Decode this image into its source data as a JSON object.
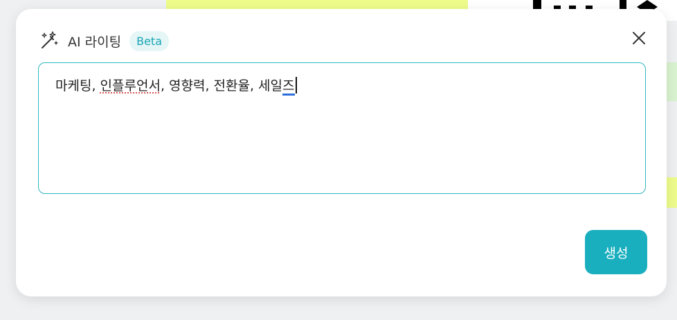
{
  "header": {
    "title": "AI 라이팅",
    "badge": "Beta",
    "icon": "magic-wand-icon"
  },
  "close": {
    "icon": "close-icon"
  },
  "editor": {
    "segments": [
      {
        "text": "마케팅, ",
        "style": "normal"
      },
      {
        "text": "인플루언서",
        "style": "misspelled"
      },
      {
        "text": ", 영향력, 전환율, 세일",
        "style": "normal"
      },
      {
        "text": "즈",
        "style": "composing"
      }
    ]
  },
  "actions": {
    "generate_label": "생성"
  },
  "colors": {
    "accent": "#1aafbe",
    "badge_bg": "#e6f6f7",
    "badge_text": "#1aa5b4",
    "editor_border": "#2fb5c2"
  }
}
